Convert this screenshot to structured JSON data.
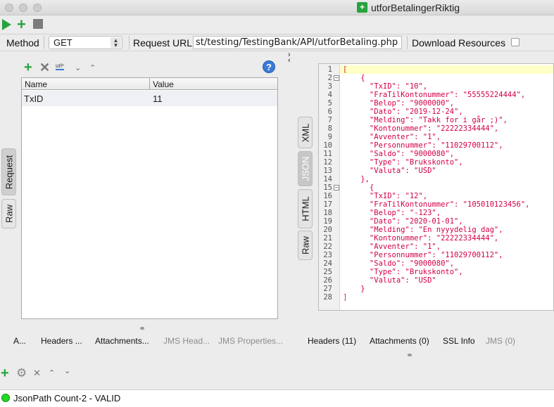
{
  "window": {
    "title": "utforBetalingerRiktig"
  },
  "request": {
    "method_label": "Method",
    "method_value": "GET",
    "url_label": "Request URL:",
    "url_value": "st/testing/TestingBank/API/utforBetaling.php",
    "download_label": "Download Resources",
    "download_checked": false
  },
  "left_tabs": [
    "Request",
    "Raw"
  ],
  "params": {
    "columns": [
      "Name",
      "Value"
    ],
    "rows": [
      {
        "name": "TxID",
        "value": "11"
      }
    ]
  },
  "response_tabs": [
    "XML",
    "JSON",
    "HTML",
    "Raw"
  ],
  "response_active_tab": "JSON",
  "json_lines": [
    "[",
    "    {",
    "      \"TxID\": \"10\",",
    "      \"FraTilKontonummer\": \"55555224444\",",
    "      \"Belop\": \"9000000\",",
    "      \"Dato\": \"2019-12-24\",",
    "      \"Melding\": \"Takk for i går ;)\",",
    "      \"Kontonummer\": \"22222334444\",",
    "      \"Avventer\": \"1\",",
    "      \"Personnummer\": \"11029700112\",",
    "      \"Saldo\": \"9000080\",",
    "      \"Type\": \"Brukskonto\",",
    "      \"Valuta\": \"USD\"",
    "    },",
    "      {",
    "      \"TxID\": \"12\",",
    "      \"FraTilKontonummer\": \"105010123456\",",
    "      \"Belop\": \"-123\",",
    "      \"Dato\": \"2020-01-01\",",
    "      \"Melding\": \"En nyyydelig dag\",",
    "      \"Kontonummer\": \"22222334444\",",
    "      \"Avventer\": \"1\",",
    "      \"Personnummer\": \"11029700112\",",
    "      \"Saldo\": \"9000080\",",
    "      \"Type\": \"Brukskonto\",",
    "      \"Valuta\": \"USD\"",
    "    }",
    "]"
  ],
  "request_bottom_tabs": [
    "A...",
    "Headers ...",
    "Attachments...",
    "JMS Head...",
    "JMS Properties..."
  ],
  "response_bottom_tabs": [
    "Headers (11)",
    "Attachments (0)",
    "SSL Info",
    "JMS (0)"
  ],
  "assertions": [
    {
      "label": "JsonPath Count-2 - VALID",
      "status": "valid"
    }
  ],
  "colors": {
    "green": "#27a33d",
    "json_string": "#d2004a",
    "valid": "#22d822"
  }
}
